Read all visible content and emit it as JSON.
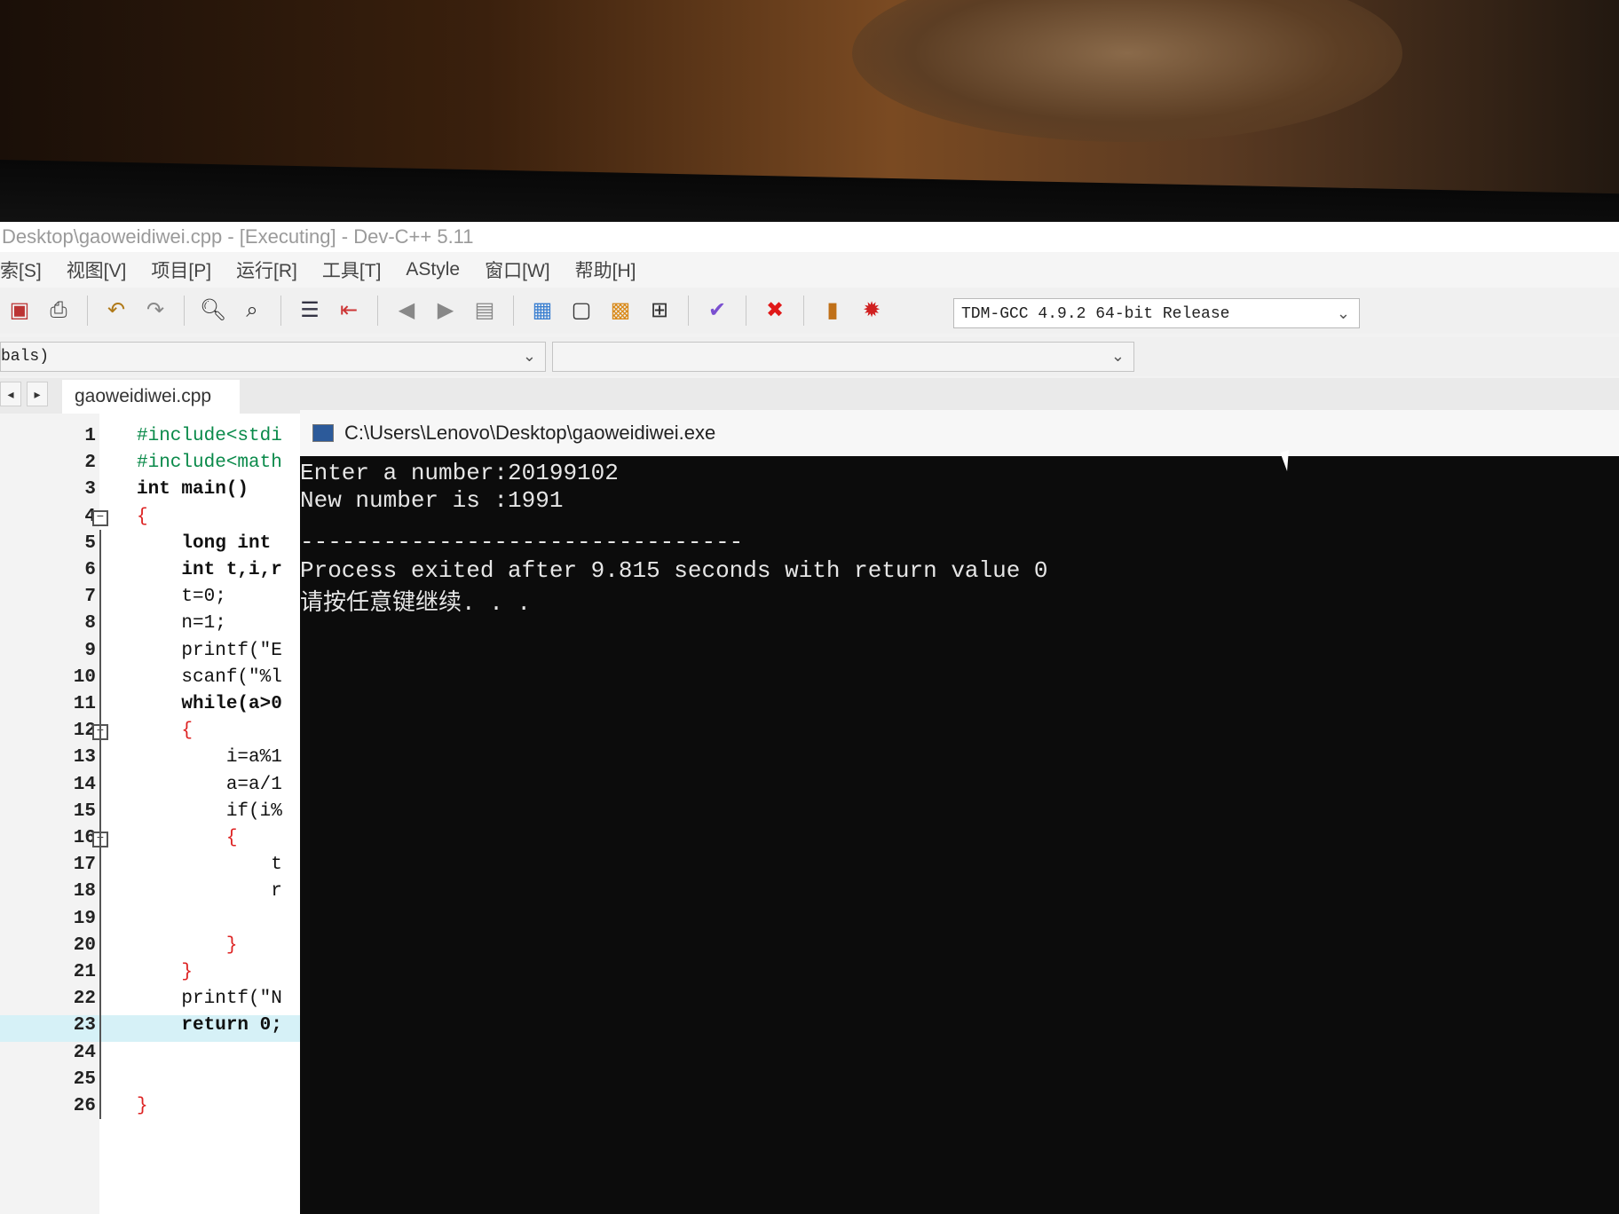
{
  "window": {
    "title": "Desktop\\gaoweidiwei.cpp - [Executing] - Dev-C++ 5.11"
  },
  "menu": [
    "索[S]",
    "视图[V]",
    "项目[P]",
    "运行[R]",
    "工具[T]",
    "AStyle",
    "窗口[W]",
    "帮助[H]"
  ],
  "toolbar": {
    "compiler": "TDM-GCC 4.9.2 64-bit Release"
  },
  "class_combo": "bals)",
  "editor": {
    "tab": "gaoweidiwei.cpp",
    "lines": [
      {
        "n": "1",
        "text": "#include<stdi"
      },
      {
        "n": "2",
        "text": "#include<math"
      },
      {
        "n": "3",
        "text": "int main()"
      },
      {
        "n": "4",
        "text": "{"
      },
      {
        "n": "5",
        "text": "    long int"
      },
      {
        "n": "6",
        "text": "    int t,i,r"
      },
      {
        "n": "7",
        "text": "    t=0;"
      },
      {
        "n": "8",
        "text": "    n=1;"
      },
      {
        "n": "9",
        "text": "    printf(\"E"
      },
      {
        "n": "10",
        "text": "    scanf(\"%l"
      },
      {
        "n": "11",
        "text": "    while(a>0"
      },
      {
        "n": "12",
        "text": "    {"
      },
      {
        "n": "13",
        "text": "        i=a%1"
      },
      {
        "n": "14",
        "text": "        a=a/1"
      },
      {
        "n": "15",
        "text": "        if(i%"
      },
      {
        "n": "16",
        "text": "        {"
      },
      {
        "n": "17",
        "text": "            t"
      },
      {
        "n": "18",
        "text": "            r"
      },
      {
        "n": "19",
        "text": ""
      },
      {
        "n": "20",
        "text": "        }"
      },
      {
        "n": "21",
        "text": "    }"
      },
      {
        "n": "22",
        "text": "    printf(\"N"
      },
      {
        "n": "23",
        "text": "    return 0;"
      },
      {
        "n": "24",
        "text": ""
      },
      {
        "n": "25",
        "text": ""
      },
      {
        "n": "26",
        "text": "}"
      }
    ]
  },
  "console": {
    "title": "C:\\Users\\Lenovo\\Desktop\\gaoweidiwei.exe",
    "lines": [
      "Enter a number:20199102",
      "New number is :1991",
      "",
      "--------------------------------",
      "Process exited after 9.815 seconds with return value 0",
      "请按任意键继续. . ."
    ]
  }
}
